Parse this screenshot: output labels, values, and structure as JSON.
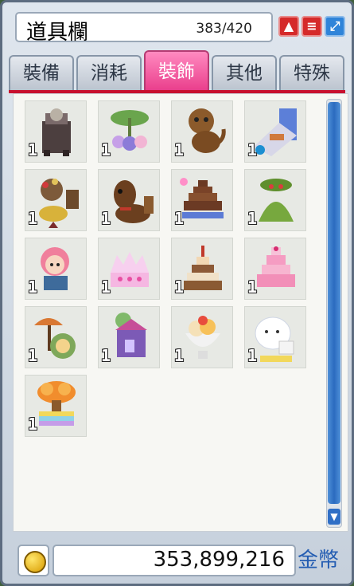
{
  "window": {
    "title": "道具欄",
    "capacity": "383/420",
    "buttons": {
      "sort": "▲",
      "menu": "≡",
      "expand": "⤢"
    }
  },
  "tabs": [
    {
      "label": "裝備"
    },
    {
      "label": "消耗"
    },
    {
      "label": "裝飾",
      "active": true
    },
    {
      "label": "其他"
    },
    {
      "label": "特殊"
    }
  ],
  "items": [
    {
      "qty": "1",
      "icon": "dark-throne-icon"
    },
    {
      "qty": "1",
      "icon": "leaf-flower-bed-icon"
    },
    {
      "qty": "1",
      "icon": "brown-cat-icon"
    },
    {
      "qty": "1",
      "icon": "blue-cart-icon"
    },
    {
      "qty": "1",
      "icon": "spinning-top-icon"
    },
    {
      "qty": "1",
      "icon": "brown-horse-icon"
    },
    {
      "qty": "1",
      "icon": "chocolate-fountain-icon"
    },
    {
      "qty": "1",
      "icon": "green-cushion-icon"
    },
    {
      "qty": "1",
      "icon": "pink-haired-girl-icon"
    },
    {
      "qty": "1",
      "icon": "pink-crown-cake-icon"
    },
    {
      "qty": "1",
      "icon": "birthday-cake-icon"
    },
    {
      "qty": "1",
      "icon": "pink-tier-cake-icon"
    },
    {
      "qty": "1",
      "icon": "umbrella-stand-icon"
    },
    {
      "qty": "1",
      "icon": "purple-house-icon"
    },
    {
      "qty": "1",
      "icon": "ice-cream-sundae-icon"
    },
    {
      "qty": "1",
      "icon": "ghost-bunny-icon"
    },
    {
      "qty": "1",
      "icon": "cloud-trophy-icon"
    }
  ],
  "footer": {
    "money": "353,899,216",
    "currency": "金幣"
  }
}
